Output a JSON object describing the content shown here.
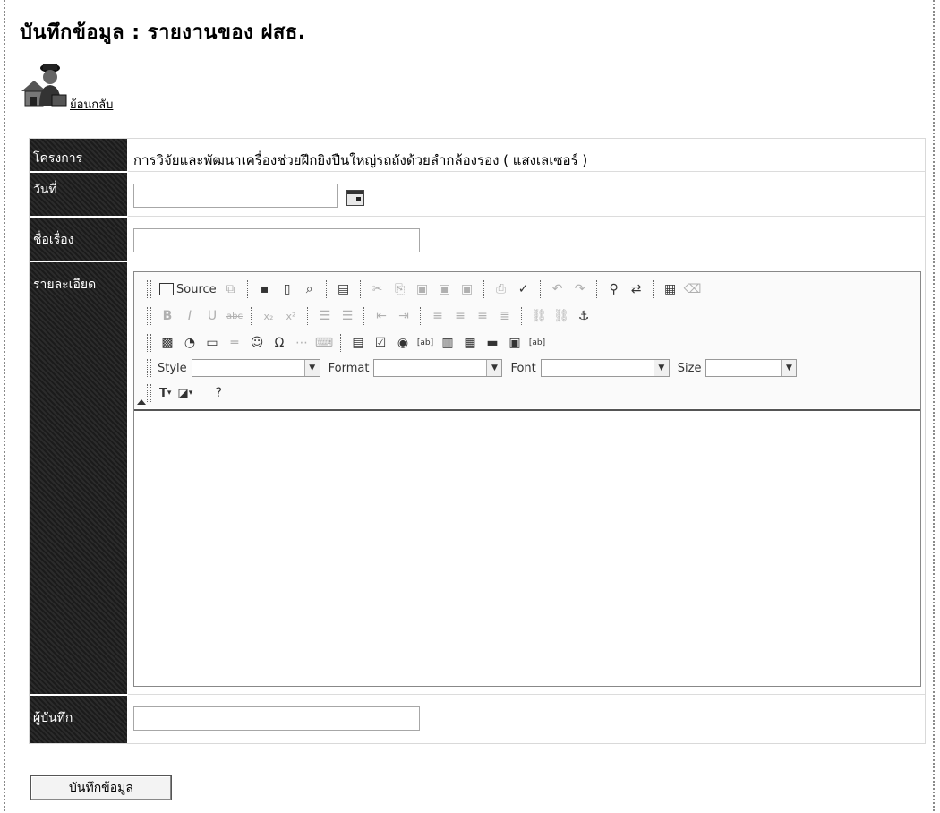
{
  "page": {
    "title": "บันทึกข้อมูล : รายงานของ ฝสธ.",
    "back_link": "ย้อนกลับ"
  },
  "form": {
    "labels": {
      "project": "โครงการ",
      "date": "วันที่",
      "subject": "ชื่อเรื่อง",
      "details": "รายละเอียด",
      "recorder": "ผู้บันทึก"
    },
    "project_value": "การวิจัยและพัฒนาเครื่องช่วยฝึกยิงปืนใหญ่รถถังด้วยลำกล้องรอง ( แสงเลเซอร์ )",
    "date_value": "",
    "subject_value": "",
    "recorder_value": ""
  },
  "editor": {
    "source_label": "Source",
    "style_label": "Style",
    "format_label": "Format",
    "font_label": "Font",
    "size_label": "Size",
    "content": ""
  },
  "submit_label": "บันทึกข้อมูล"
}
